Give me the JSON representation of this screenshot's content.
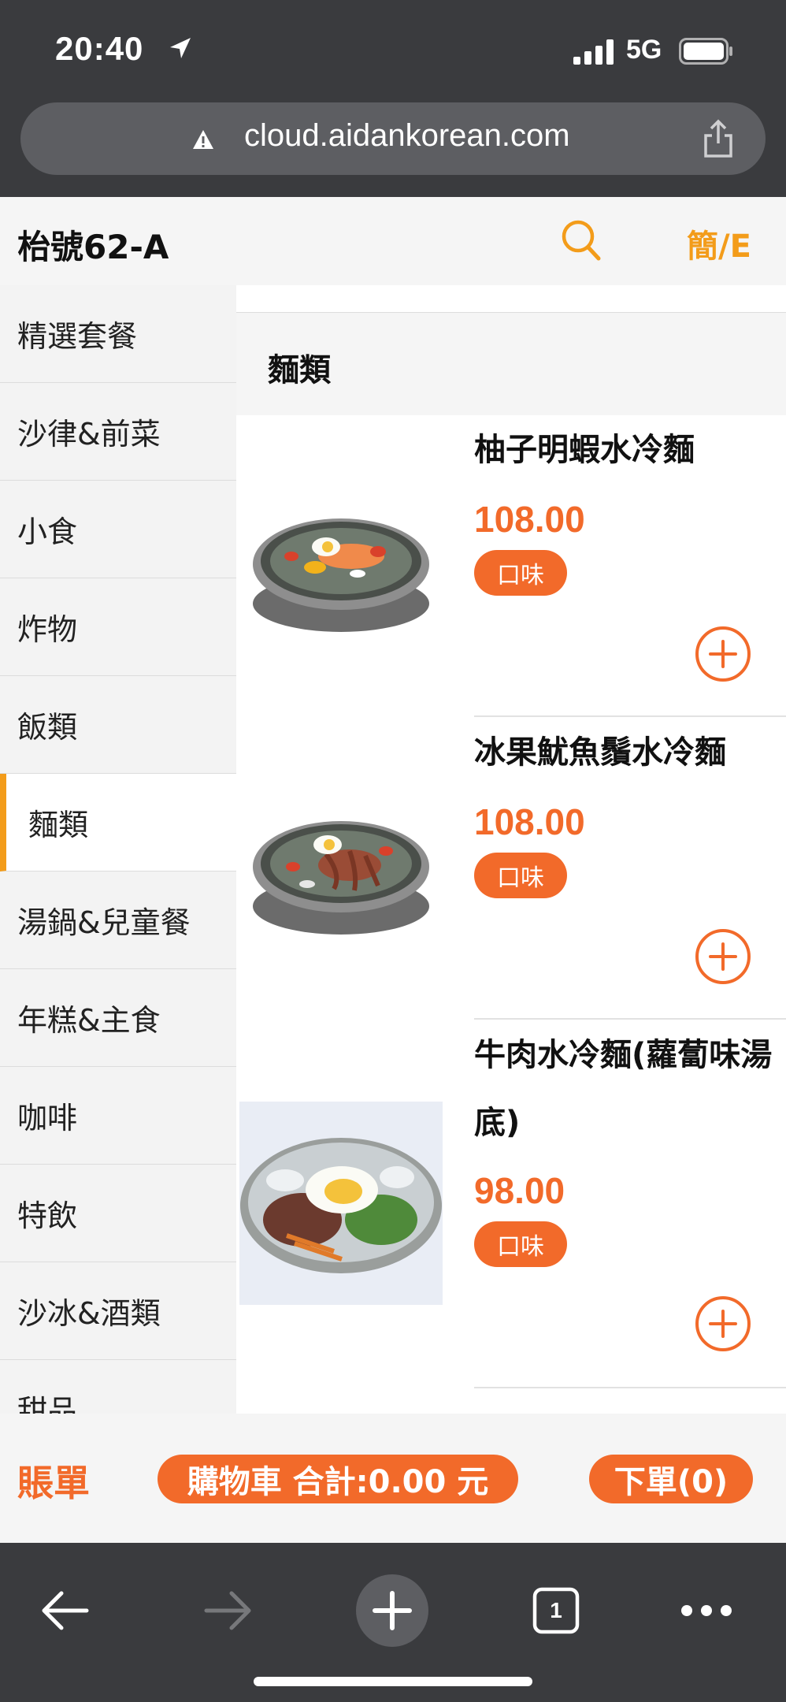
{
  "status_bar": {
    "time": "20:40",
    "network": "5G"
  },
  "browser": {
    "url": "cloud.aidankorean.com",
    "tab_count": "1"
  },
  "header": {
    "title": "枱號62-A",
    "lang_toggle": "簡/E"
  },
  "sidebar": {
    "items": [
      {
        "label": "精選套餐"
      },
      {
        "label": "沙律&前菜"
      },
      {
        "label": "小食"
      },
      {
        "label": "炸物"
      },
      {
        "label": "飯類"
      },
      {
        "label": "麵類",
        "active": true
      },
      {
        "label": "湯鍋&兒童餐"
      },
      {
        "label": "年糕&主食"
      },
      {
        "label": "咖啡"
      },
      {
        "label": "特飲"
      },
      {
        "label": "沙冰&酒類"
      },
      {
        "label": "甜品"
      }
    ]
  },
  "main": {
    "section_title": "麵類",
    "items": [
      {
        "name": "柚子明蝦水冷麵",
        "price": "108.00",
        "flavor_label": "口味"
      },
      {
        "name": "冰果魷魚鬚水冷麵",
        "price": "108.00",
        "flavor_label": "口味"
      },
      {
        "name": "牛肉水冷麵(蘿蔔味湯底)",
        "price": "98.00",
        "flavor_label": "口味"
      }
    ]
  },
  "action_bar": {
    "bill_label": "賬單",
    "cart_label": "購物車 合計:0.00 元",
    "order_label": "下單(0)"
  },
  "colors": {
    "accent_orange": "#f26a2a",
    "accent_yellow": "#f39c1a",
    "chrome_dark": "#3a3b3e"
  }
}
